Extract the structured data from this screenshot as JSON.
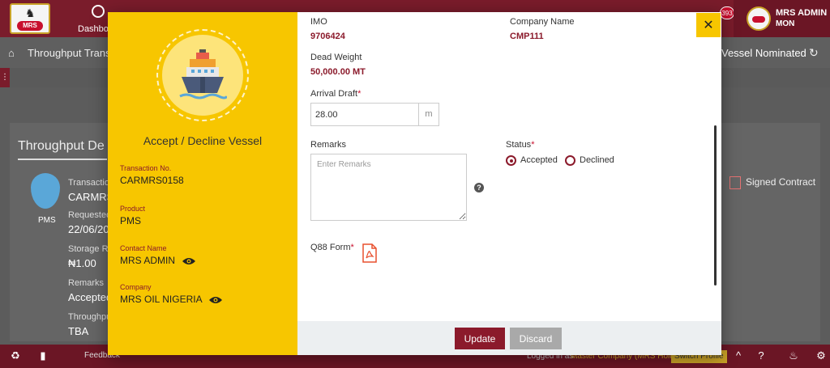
{
  "app": {
    "logo_text": "MRS",
    "nav": {
      "dashboard_label": "Dashboard"
    },
    "notification_count": "393",
    "user": {
      "name": "MRS ADMIN",
      "org": "MON"
    }
  },
  "breadcrumb": {
    "text": "Throughput Transa",
    "right_text": "Vessel Nominated"
  },
  "background_panel": {
    "title": "Throughput De",
    "icon_label": "PMS",
    "fields": [
      {
        "label": "Transaction",
        "value": "CARMRS"
      },
      {
        "label": "Requested",
        "value": "22/06/20"
      },
      {
        "label": "Storage Ra",
        "value": "₦1.00"
      },
      {
        "label": "Remarks",
        "value": "Accepted"
      },
      {
        "label": "Throughpu",
        "value": "TBA"
      }
    ],
    "signed_contract": "Signed Contract"
  },
  "footer": {
    "feedback": "Feedback",
    "logged_in_as": "Logged in as :",
    "company": "Master Company (MRS Holding)",
    "switch_profile": "Switch Profile"
  },
  "modal": {
    "title": "Accept / Decline Vessel",
    "left": {
      "transaction_no_label": "Transaction No.",
      "transaction_no": "CARMRS0158",
      "product_label": "Product",
      "product": "PMS",
      "contact_label": "Contact Name",
      "contact": "MRS ADMIN",
      "company_label": "Company",
      "company": "MRS OIL NIGERIA"
    },
    "right": {
      "imo_label": "IMO",
      "imo": "9706424",
      "company_name_label": "Company Name",
      "company_name": "CMP111",
      "dead_weight_label": "Dead Weight",
      "dead_weight": "50,000.00 MT",
      "arrival_draft_label": "Arrival Draft",
      "arrival_draft_value": "28.00",
      "arrival_draft_unit": "m",
      "remarks_label": "Remarks",
      "remarks_placeholder": "Enter Remarks",
      "status_label": "Status",
      "status_options": [
        "Accepted",
        "Declined"
      ],
      "status_selected": "Accepted",
      "q88_label": "Q88 Form",
      "required_mark": "*"
    },
    "buttons": {
      "update": "Update",
      "discard": "Discard",
      "close": "✕"
    }
  },
  "colors": {
    "maroon": "#8b1a2b",
    "yellow": "#f7c600",
    "gray_button": "#a9a9a9"
  }
}
